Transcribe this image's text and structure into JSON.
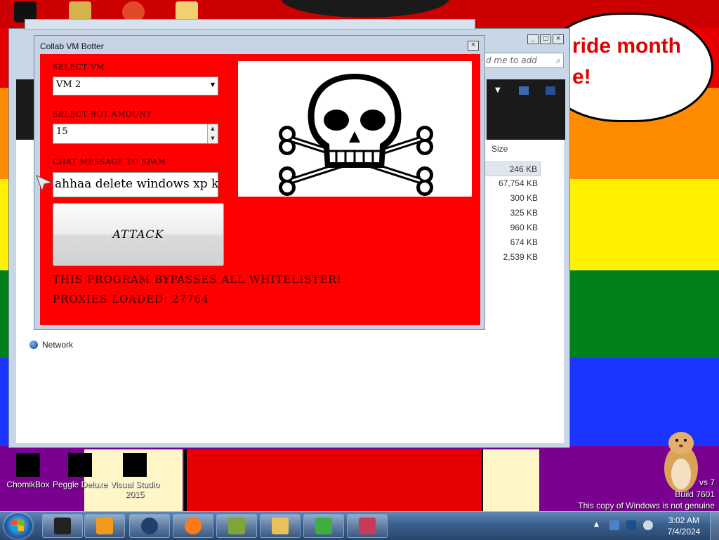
{
  "desktop": {
    "bubble_text": "ride month\ne!",
    "icons": [
      {
        "label": "ChomikBox"
      },
      {
        "label": "Peggle Deluxe"
      },
      {
        "label": "Visual Studio\n2015"
      }
    ],
    "watermark_line1": "vs 7",
    "watermark_line2": "Build 7601",
    "watermark_line3": "This copy of Windows is not genuine"
  },
  "explorer": {
    "title": "Collab VM Botter",
    "search_placeholder": "d me to add",
    "size_header": "Size",
    "sizes": [
      "246 KB",
      "67,754 KB",
      "300 KB",
      "325 KB",
      "960 KB",
      "674 KB",
      "2,539 KB"
    ],
    "network_label": "Network"
  },
  "botter": {
    "title": "Collab VM Botter",
    "select_vm_label": "SELECT VM",
    "select_vm_value": "VM 2",
    "bot_amount_label": "SELECT BOT AMOUNT",
    "bot_amount_value": "15",
    "chat_label": "CHAT MESSAGE TO SPAM",
    "chat_value": "ahhaa delete windows xp kill",
    "attack_label": "ATTACK",
    "bypass_text": "THIS PROGRAM BYPASSES ALL WHITELISTER!",
    "proxies_text": "PROXIES LOADED: 27764"
  },
  "taskbar": {
    "time": "3:02 AM",
    "date": "7/4/2024",
    "buttons": [
      {
        "icon": "black-box-icon",
        "color": "#222222"
      },
      {
        "icon": "media-player-icon",
        "color": "#f29a1c"
      },
      {
        "icon": "globe-icon",
        "color": "#1f3f6e"
      },
      {
        "icon": "firefox-icon",
        "color": "#ff7a1a"
      },
      {
        "icon": "chomikbox-icon",
        "color": "#7fa53a"
      },
      {
        "icon": "folder-icon",
        "color": "#e8c15a"
      },
      {
        "icon": "checklist-icon",
        "color": "#3fae3f"
      },
      {
        "icon": "photo-viewer-icon",
        "color": "#c73a5a"
      }
    ]
  },
  "colors": {
    "botter_bg": "#ff0000",
    "label_text": "#2a0000"
  }
}
